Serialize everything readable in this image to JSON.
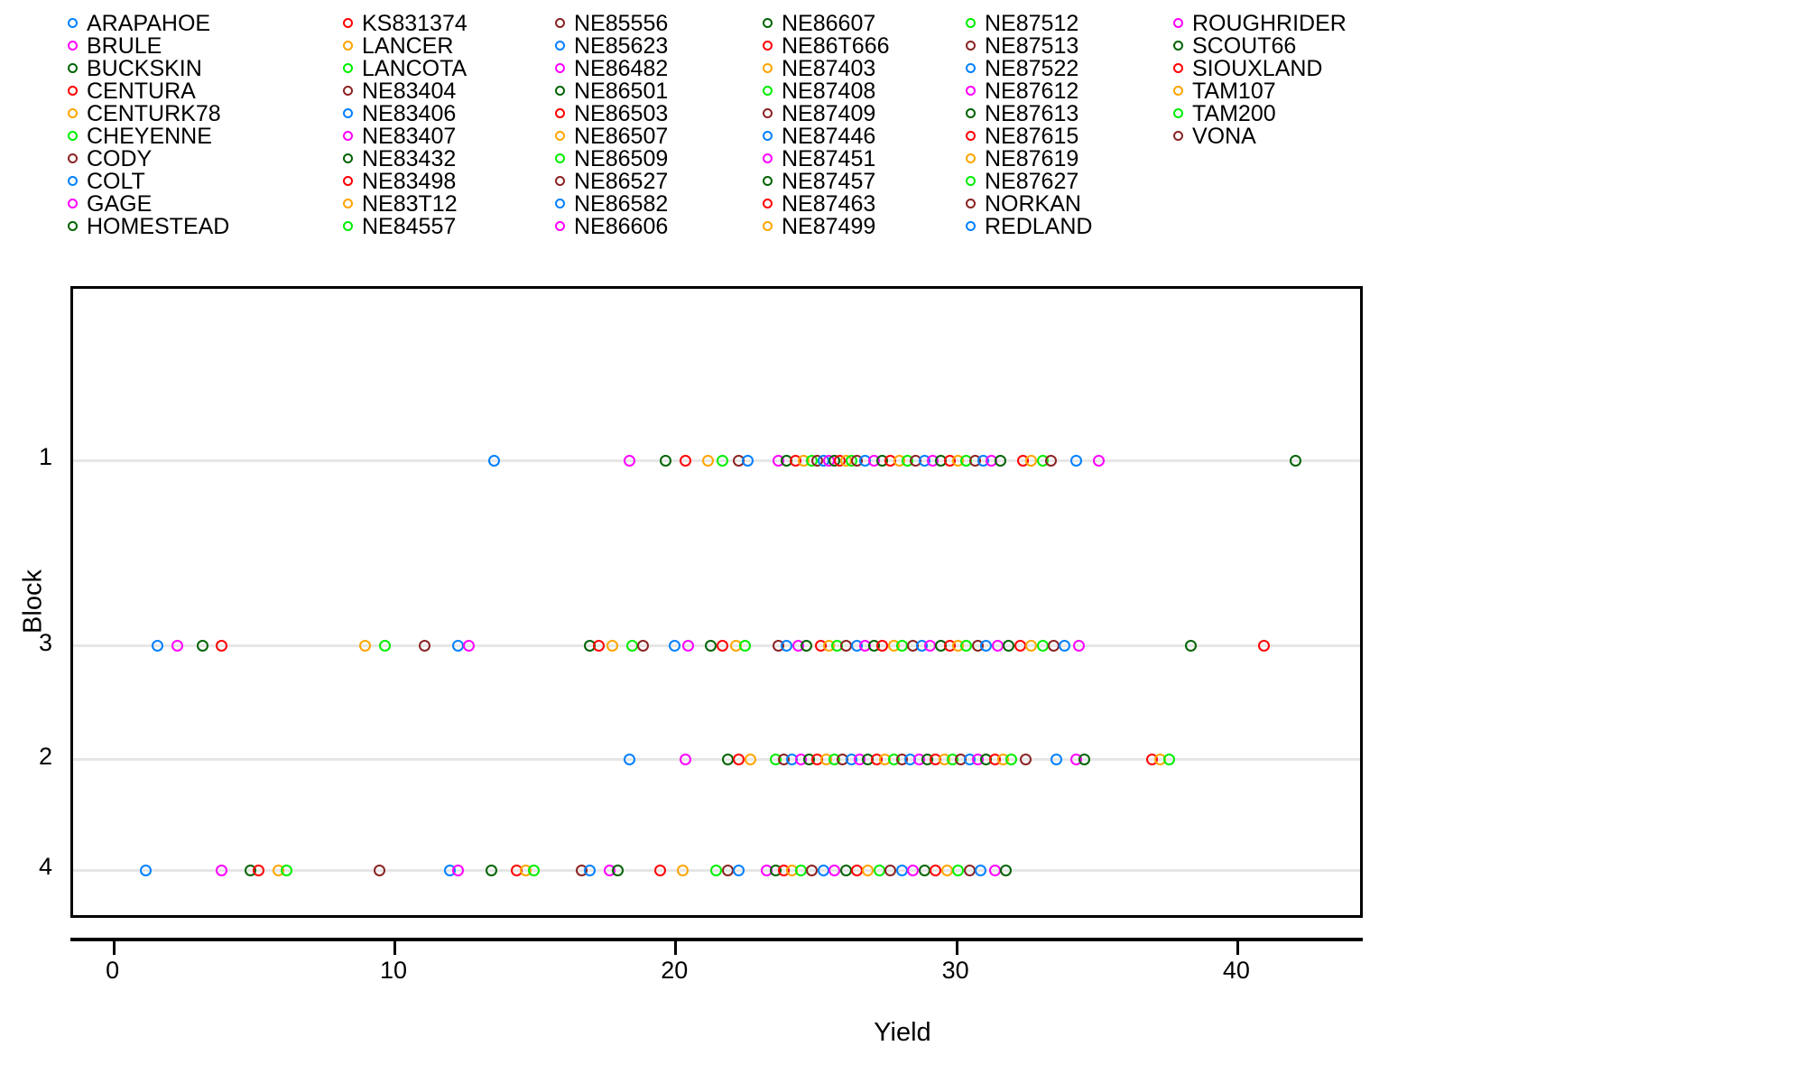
{
  "chart_data": {
    "type": "scatter",
    "title": "",
    "xlabel": "Yield",
    "ylabel": "Block",
    "xlim": [
      -1.5,
      44.5
    ],
    "xticks": [
      0,
      10,
      20,
      30,
      40
    ],
    "xticklabels": [
      "0",
      "10",
      "20",
      "30",
      "40"
    ],
    "yticklabels": [
      "1",
      "3",
      "2",
      "4"
    ],
    "ycategories": [
      "1",
      "3",
      "2",
      "4"
    ],
    "grid": "horizontal",
    "legend_position": "top",
    "marker": "open-circle",
    "palette": [
      "#0080ff",
      "#ff00ff",
      "#006400",
      "#ff0000",
      "#ffa500",
      "#00ee00",
      "#8b2323"
    ],
    "series": [
      {
        "name": "1",
        "values": [
          13.5,
          18.3,
          19.6,
          20.3,
          21.1,
          21.6,
          22.2,
          22.5,
          23.6,
          23.9,
          24.2,
          24.5,
          24.8,
          25.0,
          25.2,
          25.4,
          25.6,
          25.8,
          26.0,
          26.2,
          26.4,
          26.7,
          27.0,
          27.3,
          27.6,
          27.9,
          28.2,
          28.5,
          28.8,
          29.1,
          29.4,
          29.7,
          30.0,
          30.3,
          30.6,
          30.9,
          31.2,
          31.5,
          32.3,
          32.6,
          33.0,
          33.3,
          34.2,
          35.0,
          42.0
        ]
      },
      {
        "name": "3",
        "values": [
          1.5,
          2.2,
          3.1,
          3.8,
          8.9,
          9.6,
          11.0,
          12.2,
          12.6,
          16.9,
          17.2,
          17.7,
          18.4,
          18.8,
          19.9,
          20.4,
          21.2,
          21.6,
          22.1,
          22.4,
          23.6,
          23.9,
          24.3,
          24.6,
          25.1,
          25.4,
          25.7,
          26.0,
          26.4,
          26.7,
          27.0,
          27.3,
          27.7,
          28.0,
          28.4,
          28.7,
          29.0,
          29.4,
          29.7,
          30.0,
          30.3,
          30.7,
          31.0,
          31.4,
          31.8,
          32.2,
          32.6,
          33.0,
          33.4,
          33.8,
          34.3,
          38.3,
          40.9
        ]
      },
      {
        "name": "2",
        "values": [
          18.3,
          20.3,
          21.8,
          22.2,
          22.6,
          23.5,
          23.8,
          24.1,
          24.4,
          24.7,
          25.0,
          25.3,
          25.6,
          25.9,
          26.2,
          26.5,
          26.8,
          27.1,
          27.4,
          27.7,
          28.0,
          28.3,
          28.6,
          28.9,
          29.2,
          29.5,
          29.8,
          30.1,
          30.4,
          30.7,
          31.0,
          31.3,
          31.6,
          31.9,
          32.4,
          33.5,
          34.2,
          34.5,
          36.9,
          37.2,
          37.5
        ]
      },
      {
        "name": "4",
        "values": [
          1.1,
          3.8,
          4.8,
          5.1,
          5.8,
          6.1,
          9.4,
          11.9,
          12.2,
          13.4,
          14.3,
          14.6,
          14.9,
          16.6,
          16.9,
          17.6,
          17.9,
          19.4,
          20.2,
          21.4,
          21.8,
          22.2,
          23.2,
          23.5,
          23.8,
          24.1,
          24.4,
          24.8,
          25.2,
          25.6,
          26.0,
          26.4,
          26.8,
          27.2,
          27.6,
          28.0,
          28.4,
          28.8,
          29.2,
          29.6,
          30.0,
          30.4,
          30.8,
          31.3,
          31.7
        ]
      }
    ]
  },
  "axes": {
    "y_title": "Block",
    "x_title": "Yield",
    "y_labels": [
      "1",
      "3",
      "2",
      "4"
    ],
    "x_labels": [
      "0",
      "10",
      "20",
      "30",
      "40"
    ]
  },
  "legend": {
    "columns": [
      {
        "items": [
          {
            "label": "ARAPAHOE",
            "color": "#0080ff"
          },
          {
            "label": "BRULE",
            "color": "#ff00ff"
          },
          {
            "label": "BUCKSKIN",
            "color": "#006400"
          },
          {
            "label": "CENTURA",
            "color": "#ff0000"
          },
          {
            "label": "CENTURK78",
            "color": "#ffa500"
          },
          {
            "label": "CHEYENNE",
            "color": "#00ee00"
          },
          {
            "label": "CODY",
            "color": "#8b2323"
          },
          {
            "label": "COLT",
            "color": "#0080ff"
          },
          {
            "label": "GAGE",
            "color": "#ff00ff"
          },
          {
            "label": "HOMESTEAD",
            "color": "#006400"
          }
        ]
      },
      {
        "items": [
          {
            "label": "KS831374",
            "color": "#ff0000"
          },
          {
            "label": "LANCER",
            "color": "#ffa500"
          },
          {
            "label": "LANCOTA",
            "color": "#00ee00"
          },
          {
            "label": "NE83404",
            "color": "#8b2323"
          },
          {
            "label": "NE83406",
            "color": "#0080ff"
          },
          {
            "label": "NE83407",
            "color": "#ff00ff"
          },
          {
            "label": "NE83432",
            "color": "#006400"
          },
          {
            "label": "NE83498",
            "color": "#ff0000"
          },
          {
            "label": "NE83T12",
            "color": "#ffa500"
          },
          {
            "label": "NE84557",
            "color": "#00ee00"
          }
        ]
      },
      {
        "items": [
          {
            "label": "NE85556",
            "color": "#8b2323"
          },
          {
            "label": "NE85623",
            "color": "#0080ff"
          },
          {
            "label": "NE86482",
            "color": "#ff00ff"
          },
          {
            "label": "NE86501",
            "color": "#006400"
          },
          {
            "label": "NE86503",
            "color": "#ff0000"
          },
          {
            "label": "NE86507",
            "color": "#ffa500"
          },
          {
            "label": "NE86509",
            "color": "#00ee00"
          },
          {
            "label": "NE86527",
            "color": "#8b2323"
          },
          {
            "label": "NE86582",
            "color": "#0080ff"
          },
          {
            "label": "NE86606",
            "color": "#ff00ff"
          }
        ]
      },
      {
        "items": [
          {
            "label": "NE86607",
            "color": "#006400"
          },
          {
            "label": "NE86T666",
            "color": "#ff0000"
          },
          {
            "label": "NE87403",
            "color": "#ffa500"
          },
          {
            "label": "NE87408",
            "color": "#00ee00"
          },
          {
            "label": "NE87409",
            "color": "#8b2323"
          },
          {
            "label": "NE87446",
            "color": "#0080ff"
          },
          {
            "label": "NE87451",
            "color": "#ff00ff"
          },
          {
            "label": "NE87457",
            "color": "#006400"
          },
          {
            "label": "NE87463",
            "color": "#ff0000"
          },
          {
            "label": "NE87499",
            "color": "#ffa500"
          }
        ]
      },
      {
        "items": [
          {
            "label": "NE87512",
            "color": "#00ee00"
          },
          {
            "label": "NE87513",
            "color": "#8b2323"
          },
          {
            "label": "NE87522",
            "color": "#0080ff"
          },
          {
            "label": "NE87612",
            "color": "#ff00ff"
          },
          {
            "label": "NE87613",
            "color": "#006400"
          },
          {
            "label": "NE87615",
            "color": "#ff0000"
          },
          {
            "label": "NE87619",
            "color": "#ffa500"
          },
          {
            "label": "NE87627",
            "color": "#00ee00"
          },
          {
            "label": "NORKAN",
            "color": "#8b2323"
          },
          {
            "label": "REDLAND",
            "color": "#0080ff"
          }
        ]
      },
      {
        "items": [
          {
            "label": "ROUGHRIDER",
            "color": "#ff00ff"
          },
          {
            "label": "SCOUT66",
            "color": "#006400"
          },
          {
            "label": "SIOUXLAND",
            "color": "#ff0000"
          },
          {
            "label": "TAM107",
            "color": "#ffa500"
          },
          {
            "label": "TAM200",
            "color": "#00ee00"
          },
          {
            "label": "VONA",
            "color": "#8b2323"
          }
        ]
      }
    ]
  }
}
